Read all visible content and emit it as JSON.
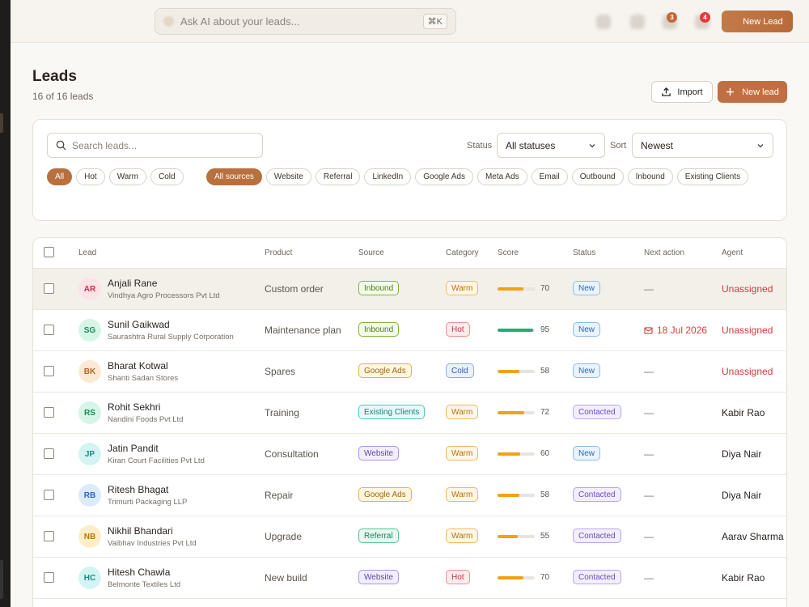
{
  "topbar": {
    "ask_placeholder": "Ask AI about your leads...",
    "ask_shortcut": "⌘K",
    "badge_a": "3",
    "badge_b": "4",
    "new_lead": "New Lead"
  },
  "header": {
    "title": "Leads",
    "subtitle": "16 of 16 leads",
    "import_label": "Import",
    "new_lead_label": "New lead"
  },
  "filters": {
    "search_placeholder": "Search leads...",
    "status_label": "Status",
    "status_value": "All statuses",
    "sort_label": "Sort",
    "sort_value": "Newest",
    "categories": [
      "All",
      "Hot",
      "Warm",
      "Cold"
    ],
    "sources": [
      "All sources",
      "Website",
      "Referral",
      "LinkedIn",
      "Google Ads",
      "Meta Ads",
      "Email",
      "Outbound",
      "Inbound",
      "Existing Clients"
    ]
  },
  "table": {
    "columns": {
      "lead": "Lead",
      "product": "Product",
      "source": "Source",
      "category": "Category",
      "score": "Score",
      "status": "Status",
      "next_action": "Next action",
      "agent": "Agent"
    },
    "rows": [
      {
        "initials": "AR",
        "name": "Anjali Rane",
        "company": "Vindhya Agro Processors Pvt Ltd",
        "product": "Custom order",
        "source": "Inbound",
        "category": "Warm",
        "score": 70,
        "status": "New",
        "next_action": "—",
        "agent": "Unassigned"
      },
      {
        "initials": "SG",
        "name": "Sunil Gaikwad",
        "company": "Saurashtra Rural Supply Corporation",
        "product": "Maintenance plan",
        "source": "Inbound",
        "category": "Hot",
        "score": 95,
        "status": "New",
        "next_action": "18 Jul 2026",
        "agent": "Unassigned"
      },
      {
        "initials": "BK",
        "name": "Bharat Kotwal",
        "company": "Shanti Sadan Stores",
        "product": "Spares",
        "source": "Google Ads",
        "category": "Cold",
        "score": 58,
        "status": "New",
        "next_action": "—",
        "agent": "Unassigned"
      },
      {
        "initials": "RS",
        "name": "Rohit Sekhri",
        "company": "Nandini Foods Pvt Ltd",
        "product": "Training",
        "source": "Existing Clients",
        "category": "Warm",
        "score": 72,
        "status": "Contacted",
        "next_action": "—",
        "agent": "Kabir Rao"
      },
      {
        "initials": "JP",
        "name": "Jatin Pandit",
        "company": "Kiran Court Facilities Pvt Ltd",
        "product": "Consultation",
        "source": "Website",
        "category": "Warm",
        "score": 60,
        "status": "New",
        "next_action": "—",
        "agent": "Diya Nair"
      },
      {
        "initials": "RB",
        "name": "Ritesh Bhagat",
        "company": "Trimurti Packaging LLP",
        "product": "Repair",
        "source": "Google Ads",
        "category": "Warm",
        "score": 58,
        "status": "Contacted",
        "next_action": "—",
        "agent": "Diya Nair"
      },
      {
        "initials": "NB",
        "name": "Nikhil Bhandari",
        "company": "Vaibhav Industries Pvt Ltd",
        "product": "Upgrade",
        "source": "Referral",
        "category": "Warm",
        "score": 55,
        "status": "Contacted",
        "next_action": "—",
        "agent": "Aarav Sharma"
      },
      {
        "initials": "HC",
        "name": "Hitesh Chawla",
        "company": "Belmonte Textiles Ltd",
        "product": "New build",
        "source": "Website",
        "category": "Hot",
        "score": 70,
        "status": "Contacted",
        "next_action": "—",
        "agent": "Kabir Rao"
      }
    ]
  },
  "colors": {
    "accent": "#b8703f",
    "score_bar": "#f2a20c",
    "score_bar_high": "#1fae74",
    "unassigned": "#d6363c"
  }
}
